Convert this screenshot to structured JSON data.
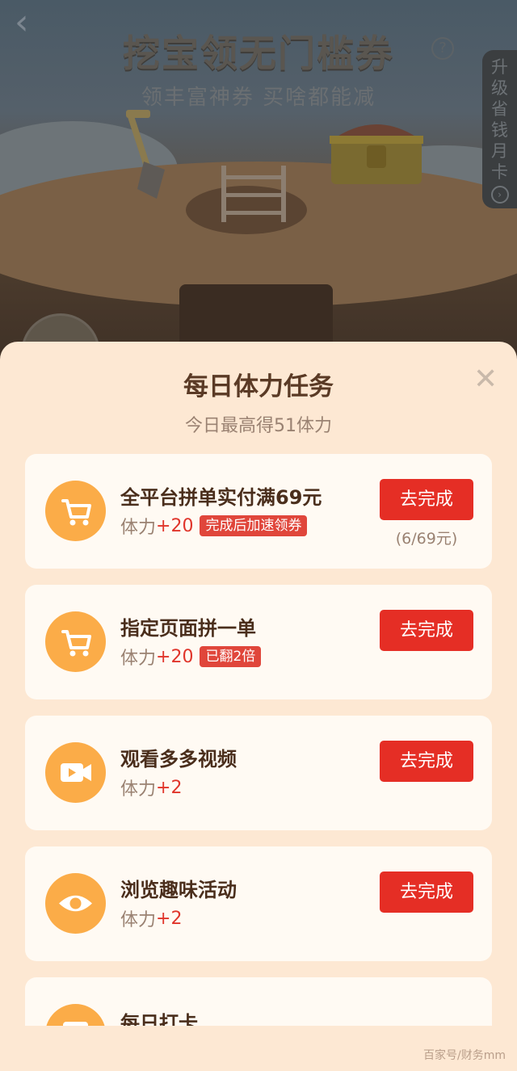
{
  "header": {
    "back_icon": "chevron-left-icon",
    "title": "挖宝领无门槛券",
    "subtitle": "领丰富神券 买啥都能减",
    "help_icon": "question-circle-icon",
    "side_tab": "升级省钱月卡",
    "side_tab_icon": "chevron-right-circle-icon"
  },
  "sheet": {
    "title": "每日体力任务",
    "subtitle": "今日最高得51体力",
    "close_icon": "close-icon",
    "reward_prefix": "体力",
    "tasks": [
      {
        "icon": "shopping-cart-icon",
        "name": "全平台拼单实付满69元",
        "reward": "+20",
        "badge": "完成后加速领券",
        "button": "去完成",
        "progress": "(6/69元)"
      },
      {
        "icon": "shopping-cart-icon",
        "name": "指定页面拼一单",
        "reward": "+20",
        "badge": "已翻2倍",
        "button": "去完成"
      },
      {
        "icon": "video-camera-icon",
        "name": "观看多多视频",
        "reward": "+2",
        "button": "去完成"
      },
      {
        "icon": "eye-icon",
        "name": "浏览趣味活动",
        "reward": "+2",
        "button": "去完成"
      },
      {
        "icon": "calendar-icon",
        "name": "每日打卡"
      }
    ]
  },
  "watermark": "百家号/财务mm",
  "colors": {
    "accent_red": "#e52e25",
    "icon_orange": "#fbac48",
    "sheet_bg": "#fde8d3",
    "card_bg": "#fffaf3"
  }
}
